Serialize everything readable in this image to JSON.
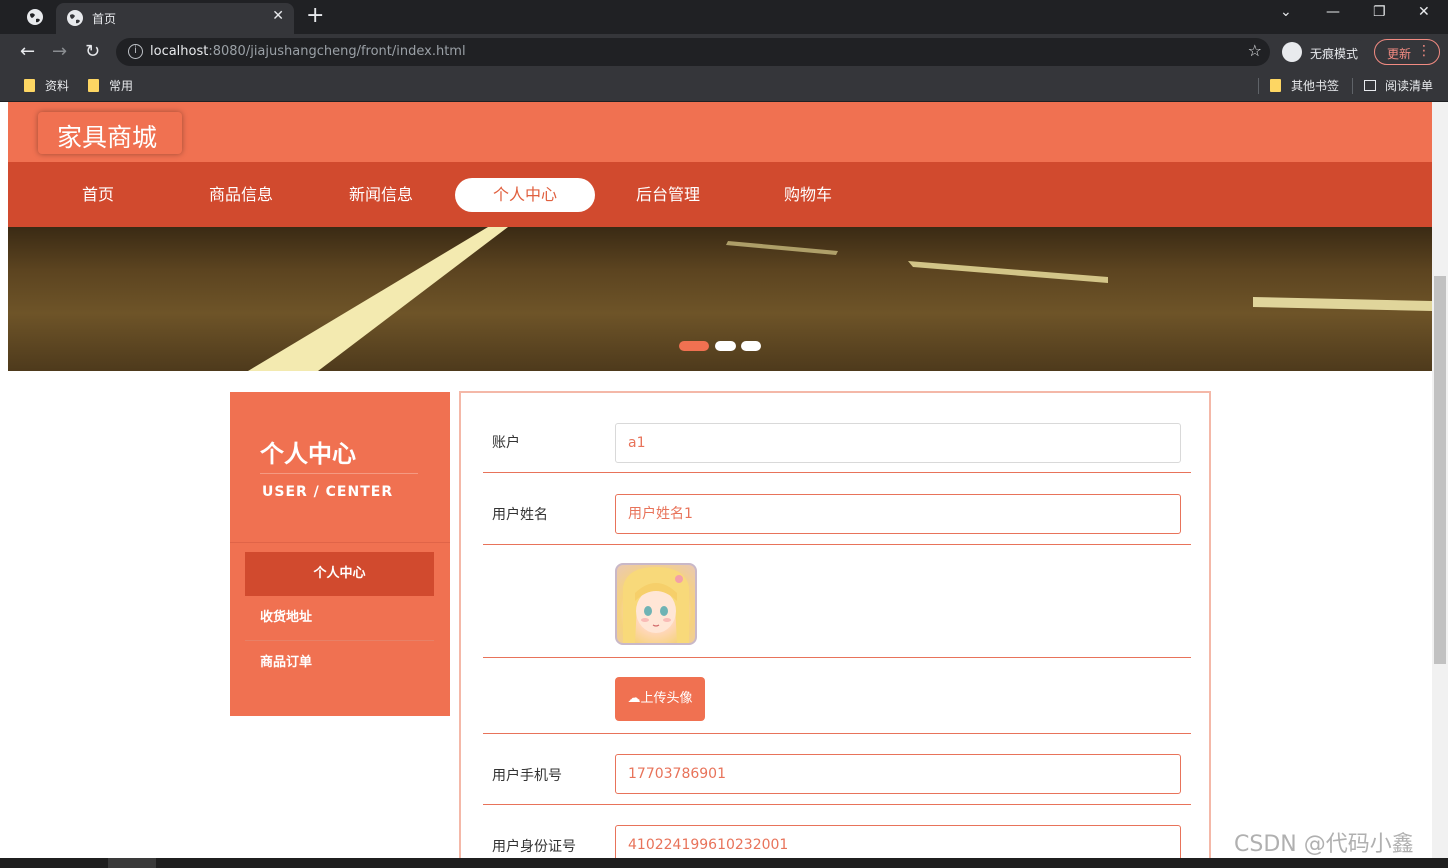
{
  "browser": {
    "tab_title": "首页",
    "url_host": "localhost",
    "url_rest": ":8080/jiajushangcheng/front/index.html",
    "incognito_label": "无痕模式",
    "update_label": "更新",
    "bookmarks": [
      "资料",
      "常用"
    ],
    "bookmarks_right": [
      "其他书签",
      "阅读清单"
    ]
  },
  "site": {
    "logo": "家具商城",
    "nav": [
      "首页",
      "商品信息",
      "新闻信息",
      "个人中心",
      "后台管理",
      "购物车"
    ],
    "active_nav": "个人中心"
  },
  "sidebar": {
    "title": "个人中心",
    "subtitle": "USER / CENTER",
    "items": [
      "个人中心",
      "收货地址",
      "商品订单"
    ]
  },
  "form": {
    "account_label": "账户",
    "account_value": "a1",
    "name_label": "用户姓名",
    "name_value": "用户姓名1",
    "upload_label": "上传头像",
    "phone_label": "用户手机号",
    "phone_value": "17703786901",
    "idcard_label": "用户身份证号",
    "idcard_value": "410224199610232001"
  },
  "watermark": "CSDN @代码小鑫",
  "colors": {
    "brand": "#f07151",
    "nav": "#d14a2e",
    "accent_border": "#e8735a"
  }
}
